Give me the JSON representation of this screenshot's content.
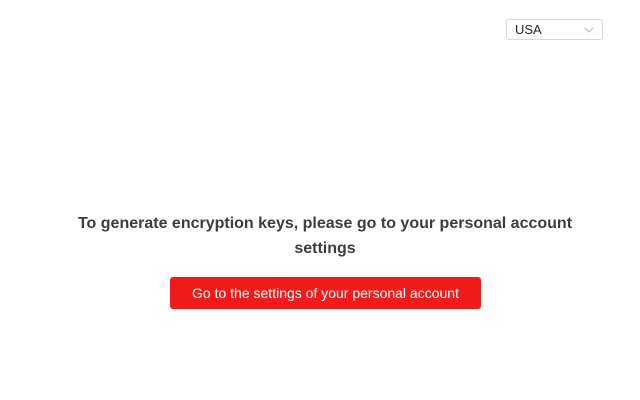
{
  "header": {
    "region_select": {
      "value": "USA",
      "icon": "chevron-down-icon"
    }
  },
  "main": {
    "message": "To generate encryption keys, please go to your personal account settings",
    "settings_button_label": "Go to the settings of your personal account"
  },
  "colors": {
    "button_background": "#f21b1b",
    "button_text": "#ffffff",
    "message_text": "#3d3d3d",
    "select_border": "#d9d9d9"
  }
}
